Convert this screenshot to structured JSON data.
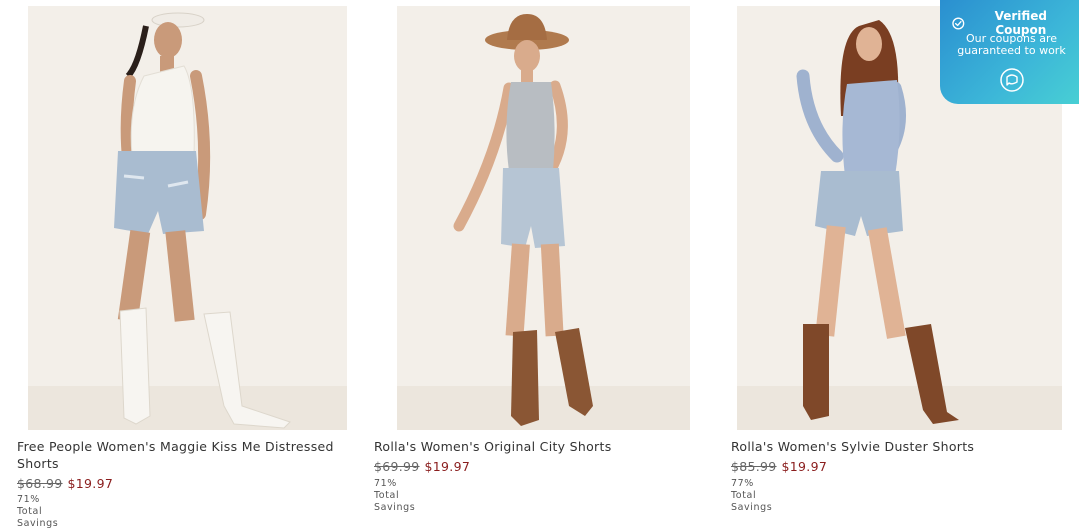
{
  "products": [
    {
      "title": "Free People Women's Maggie Kiss Me Distressed Shorts",
      "original_price": "$68.99",
      "sale_price": "$19.97",
      "savings": "71% Total Savings"
    },
    {
      "title": "Rolla's Women's Original City Shorts",
      "original_price": "$69.99",
      "sale_price": "$19.97",
      "savings": "71% Total Savings"
    },
    {
      "title": "Rolla's Women's Sylvie Duster Shorts",
      "original_price": "$85.99",
      "sale_price": "$19.97",
      "savings": "77% Total Savings"
    }
  ],
  "coupon_badge": {
    "title": "Verified Coupon",
    "subtitle": "Our coupons are guaranteed to work",
    "check_icon": "check-circle-icon",
    "action_icon": "chat-bubble-icon"
  },
  "colors": {
    "sale_price": "#8a1d1d",
    "badge_gradient_start": "#2a8fd0",
    "badge_gradient_end": "#48cfd4"
  }
}
